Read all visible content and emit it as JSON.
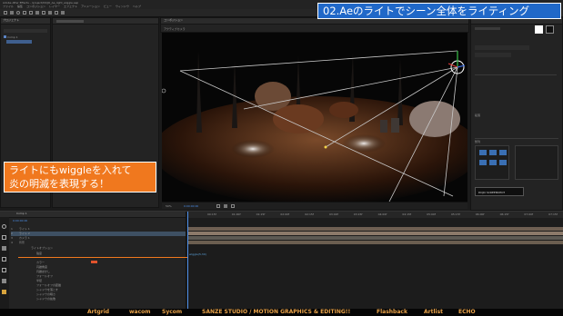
{
  "app": {
    "menu_items": [
      "ファイル",
      "編集",
      "コンポジション",
      "レイヤー",
      "エフェクト",
      "アニメーション",
      "ビュー",
      "ウィンドウ",
      "ヘルプ"
    ],
    "window_title": "Adobe After Effects - /project/DOJO_Ae_light_wiggle.aep"
  },
  "title_banner": "02.Aeのライトでシーン全体をライティング",
  "caption": {
    "line1": "ライトにもwiggleを入れて",
    "line2": "炎の明滅を表現する！"
  },
  "project_panel": {
    "tab": "プロジェクト",
    "item": "Comp 1"
  },
  "viewer": {
    "tab": "コンポジション",
    "comp_label": "アクティブカメラ",
    "zoom": "50%",
    "timecode": "0:00:00:00"
  },
  "right_panel": {
    "align_header": "整列",
    "paragraph_header": "段落",
    "info_header": "情報",
    "logo_text": "DOJO SCREENSHOT",
    "accent_color": "#d6d6d6"
  },
  "timeline": {
    "tab": "Comp 1",
    "timecode": "0:00:00:00",
    "layers": [
      {
        "num": "1",
        "name": "ライト 1",
        "selected": false
      },
      {
        "num": "2",
        "name": "ライト 2",
        "selected": true
      },
      {
        "num": "3",
        "name": "カメラ 1",
        "selected": false
      },
      {
        "num": "4",
        "name": "背景",
        "selected": false
      }
    ],
    "properties": [
      "ライトオプション",
      "強度",
      "カラー",
      "円錐角度",
      "円錐ぼかし",
      "フォールオフ",
      "半径",
      "フォールオフの距離",
      "シャドウを落とす",
      "シャドウの暗さ",
      "シャドウの拡散"
    ],
    "expression": "wiggle(5,30)",
    "ruler_ticks": [
      "00:15f",
      "01:00f",
      "01:15f",
      "02:00f",
      "02:15f",
      "03:00f",
      "03:15f",
      "04:00f",
      "04:15f",
      "05:00f",
      "05:15f",
      "06:00f",
      "06:15f",
      "07:00f",
      "07:15f"
    ]
  },
  "footer_sponsors": [
    "Artgrid",
    "wacom",
    "Sycom",
    "SANZE STUDIO / MOTION GRAPHICS & EDITING!!",
    "Flashback",
    "Artlist",
    "ECHO"
  ]
}
